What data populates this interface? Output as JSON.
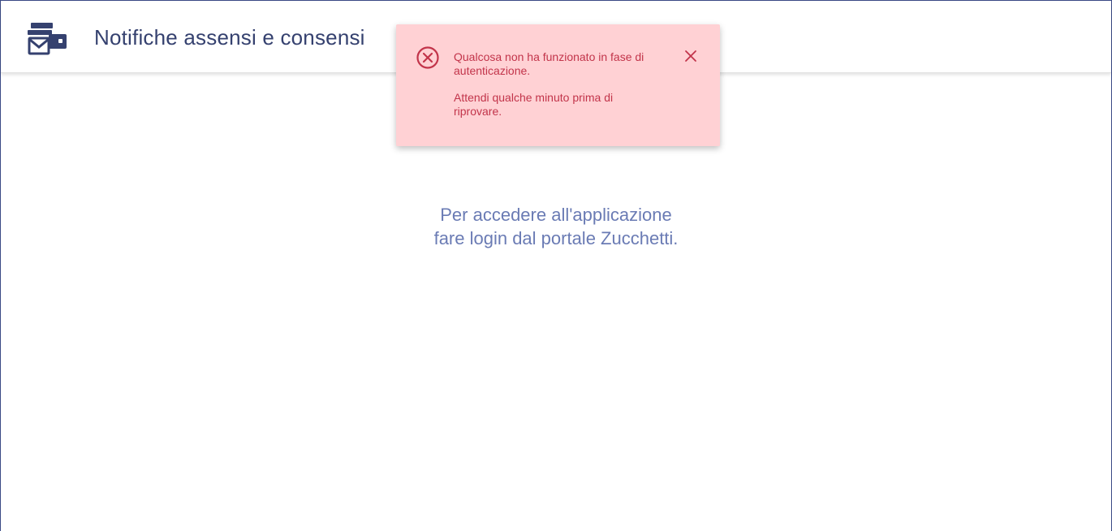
{
  "header": {
    "title": "Notifiche assensi e consensi",
    "logo_icon": "envelopes-wallet-icon",
    "brand_color": "#35416f"
  },
  "toast": {
    "type": "error",
    "icon": "error-circle-x-icon",
    "close_icon": "close-icon",
    "message_line1": "Qualcosa non ha funzionato in fase di",
    "message_line2": "autenticazione.",
    "hint_line1": "Attendi qualche minuto prima di",
    "hint_line2": "riprovare.",
    "background_color": "#ffd1d4",
    "text_color": "#c2344a"
  },
  "main": {
    "login_line1": "Per accedere all'applicazione",
    "login_line2": "fare login dal portale Zucchetti.",
    "text_color": "#6a7bb4"
  }
}
